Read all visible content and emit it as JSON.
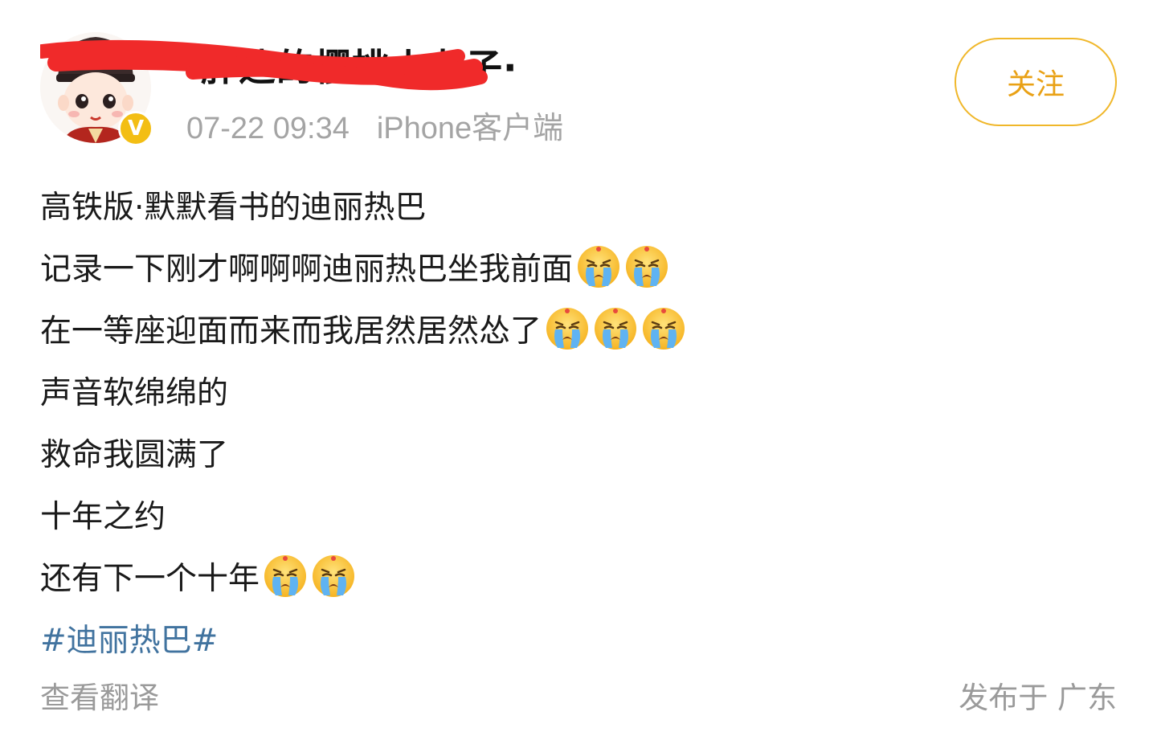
{
  "post": {
    "author": {
      "name": "胖迪的樱桃小丸子·",
      "avatar": "avatar-illustration",
      "verified_icon": "verified-v-icon",
      "verified_glyph": "V"
    },
    "meta": {
      "timestamp": "07-22 09:34",
      "client": "iPhone客户端"
    },
    "follow_label": "关注",
    "lines": [
      {
        "text": "高铁版·默默看书的迪丽热巴",
        "emoji_count": 0
      },
      {
        "text": "记录一下刚才啊啊啊迪丽热巴坐我前面",
        "emoji_count": 2
      },
      {
        "text": "在一等座迎面而来而我居然居然怂了",
        "emoji_count": 3
      },
      {
        "text": "声音软绵绵的",
        "emoji_count": 0
      },
      {
        "text": "救命我圆满了",
        "emoji_count": 0
      },
      {
        "text": "十年之约",
        "emoji_count": 0
      },
      {
        "text": "还有下一个十年",
        "emoji_count": 2
      }
    ],
    "emoji_name": "crying-face-emoji",
    "hashtag": "#迪丽热巴#",
    "translate_label": "查看翻译",
    "location": "发布于 广东"
  },
  "colors": {
    "accent": "#f0b72a",
    "follow_text": "#e9a115",
    "hashtag": "#41739f",
    "meta": "#a4a4a4",
    "redaction": "#f02a2a"
  }
}
